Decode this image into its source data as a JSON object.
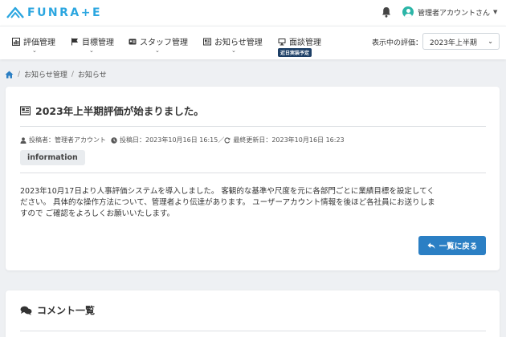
{
  "header": {
    "logo_text": "FUNRA+E",
    "logo_color": "#2ba6e0",
    "notification_icon": "bell-icon",
    "user_name": "管理者アカウントさん"
  },
  "nav": {
    "items": [
      {
        "label": "評価管理",
        "icon": "bar-chart-icon"
      },
      {
        "label": "目標管理",
        "icon": "flag-icon"
      },
      {
        "label": "スタッフ管理",
        "icon": "id-card-icon"
      },
      {
        "label": "お知らせ管理",
        "icon": "newspaper-icon"
      },
      {
        "label": "面談管理",
        "icon": "monitor-icon",
        "badge": "近日実装予定"
      }
    ],
    "eval_label": "表示中の評価：",
    "eval_selected": "2023年上半期"
  },
  "breadcrumb": {
    "home_icon": "home-icon",
    "items": [
      "お知らせ管理",
      "お知らせ"
    ]
  },
  "post": {
    "title": "2023年上半期評価が始まりました。",
    "author": "投稿者：管理者アカウント",
    "posted": "投稿日：2023年10月16日 16:15",
    "separator": "／",
    "updated": "最終更新日：2023年10月16日 16:23",
    "tag": "information",
    "body_lines": [
      "2023年10月17日より人事評価システムを導入しました。 客観的な基準や尺度を元に各部門ごとに業績目標を設定してく",
      "ださい。 具体的な操作方法について、管理者より伝達があります。 ユーザーアカウント情報を後ほど各社員にお送りしま",
      "すので ご確認をよろしくお願いいたします。"
    ],
    "back_button": "一覧に戻る"
  },
  "comments": {
    "title": "コメント一覧"
  },
  "colors": {
    "accent": "#2b7fc4",
    "badge": "#1d3f66",
    "background": "#eef0f3"
  }
}
